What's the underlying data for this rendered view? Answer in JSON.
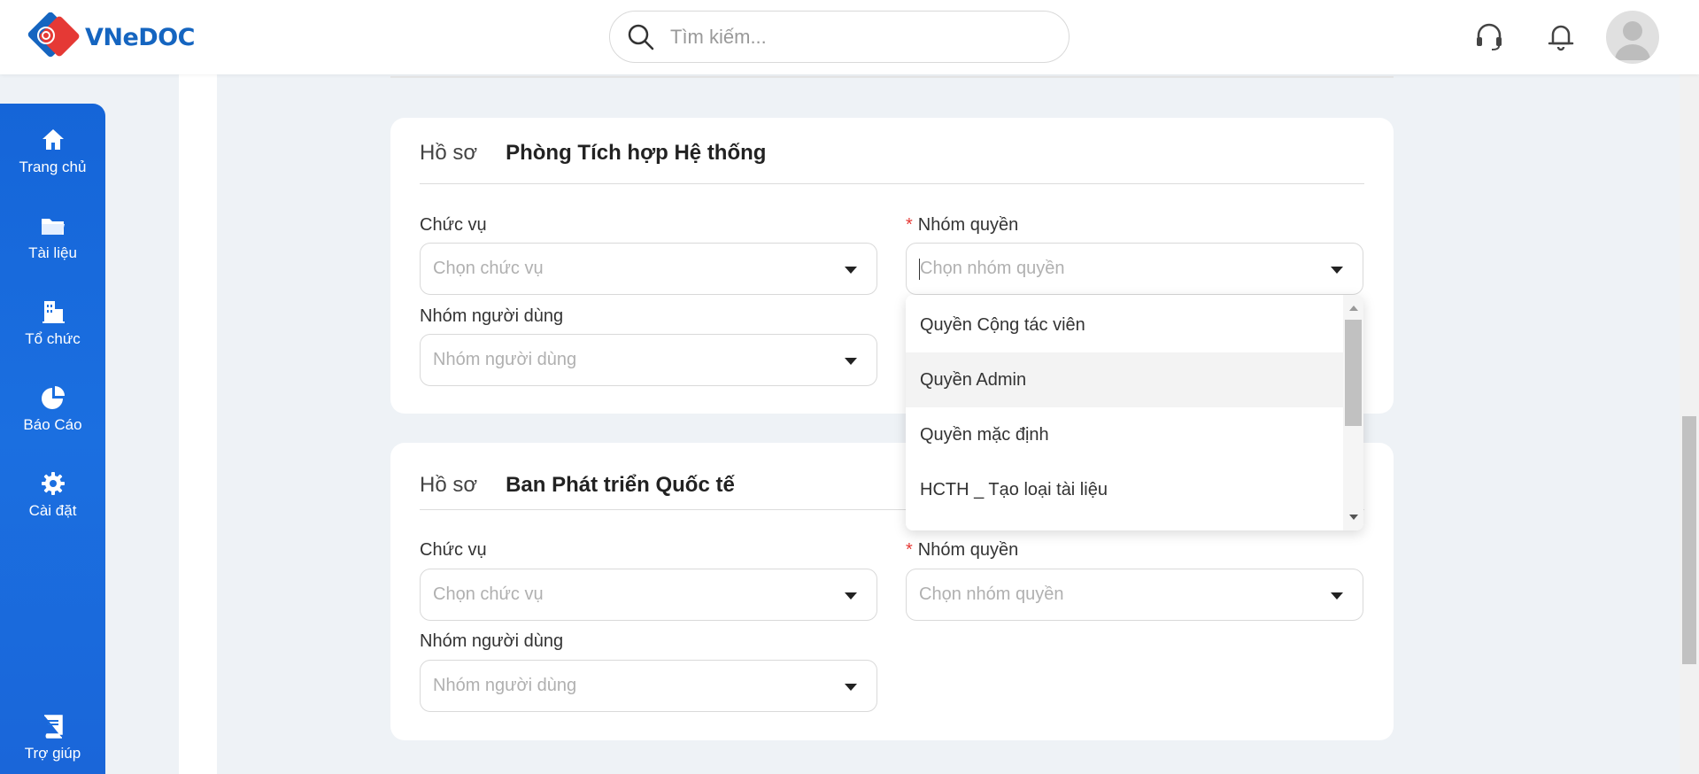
{
  "header": {
    "logo_text": "VNeDOC",
    "search_placeholder": "Tìm kiếm..."
  },
  "sidebar": {
    "items": [
      {
        "label": "Trang chủ",
        "icon": "home-icon"
      },
      {
        "label": "Tài liệu",
        "icon": "folder-icon"
      },
      {
        "label": "Tổ chức",
        "icon": "building-icon"
      },
      {
        "label": "Báo Cáo",
        "icon": "pie-chart-icon"
      },
      {
        "label": "Cài đặt",
        "icon": "gear-icon"
      }
    ],
    "help": {
      "label": "Trợ giúp",
      "icon": "book-icon"
    }
  },
  "cards": [
    {
      "prefix": "Hồ sơ",
      "title": "Phòng Tích hợp Hệ thống",
      "position_label": "Chức vụ",
      "position_placeholder": "Chọn chức vụ",
      "role_group_required": "*",
      "role_group_label": "Nhóm quyền",
      "role_group_placeholder": "Chọn nhóm quyền",
      "user_group_label": "Nhóm người dùng",
      "user_group_placeholder": "Nhóm người dùng"
    },
    {
      "prefix": "Hồ sơ",
      "title": "Ban Phát triển Quốc tế",
      "position_label": "Chức vụ",
      "position_placeholder": "Chọn chức vụ",
      "role_group_required": "*",
      "role_group_label": "Nhóm quyền",
      "role_group_placeholder": "Chọn nhóm quyền",
      "user_group_label": "Nhóm người dùng",
      "user_group_placeholder": "Nhóm người dùng"
    }
  ],
  "dropdown": {
    "options": [
      "Quyền Cộng tác viên",
      "Quyền Admin",
      "Quyền mặc định",
      "HCTH _ Tạo loại tài liệu"
    ],
    "highlighted_index": 1
  },
  "colors": {
    "brand": "#1565c0",
    "sidebar": "#1b6fe0",
    "required": "#e53935",
    "logo_red": "#e53935"
  }
}
